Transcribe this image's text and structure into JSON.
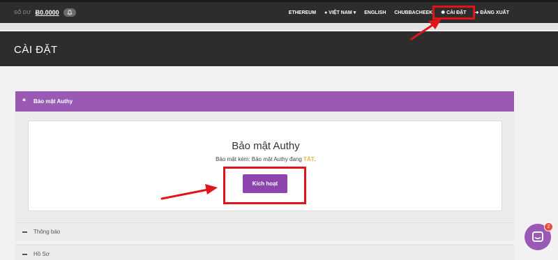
{
  "topnav": {
    "balance_label": "SỐ DƯ",
    "balance_value": "Ƀ0.0000",
    "links": [
      {
        "label": "ETHEREUM",
        "icon": ""
      },
      {
        "label": "VIỆT NAM",
        "icon": "globe-icon",
        "caret": "▾"
      },
      {
        "label": "ENGLISH",
        "icon": ""
      },
      {
        "label": "CHUBBACHEEK",
        "icon": ""
      },
      {
        "label": "CÀI ĐẶT",
        "icon": "gear-icon"
      },
      {
        "label": "ĐĂNG XUẤT",
        "icon": "logout-icon"
      }
    ]
  },
  "header": {
    "title": "CÀI ĐẶT"
  },
  "authy_panel": {
    "heading": "Bảo mật Authy",
    "card_title": "Bảo mật Authy",
    "status_prefix": "Bảo mật kém: Bảo mật Authy đang ",
    "status_value": "TẮT",
    "status_suffix": ".",
    "activate_label": "Kích hoạt"
  },
  "sections": [
    {
      "label": "Thông báo"
    },
    {
      "label": "Hồ Sơ"
    }
  ],
  "chat": {
    "badge": "2"
  },
  "colors": {
    "accent": "#9b59b6",
    "button": "#8e44ad",
    "dark": "#2d2d2d",
    "warning": "#f0ad4e",
    "highlight": "#e0141b"
  }
}
